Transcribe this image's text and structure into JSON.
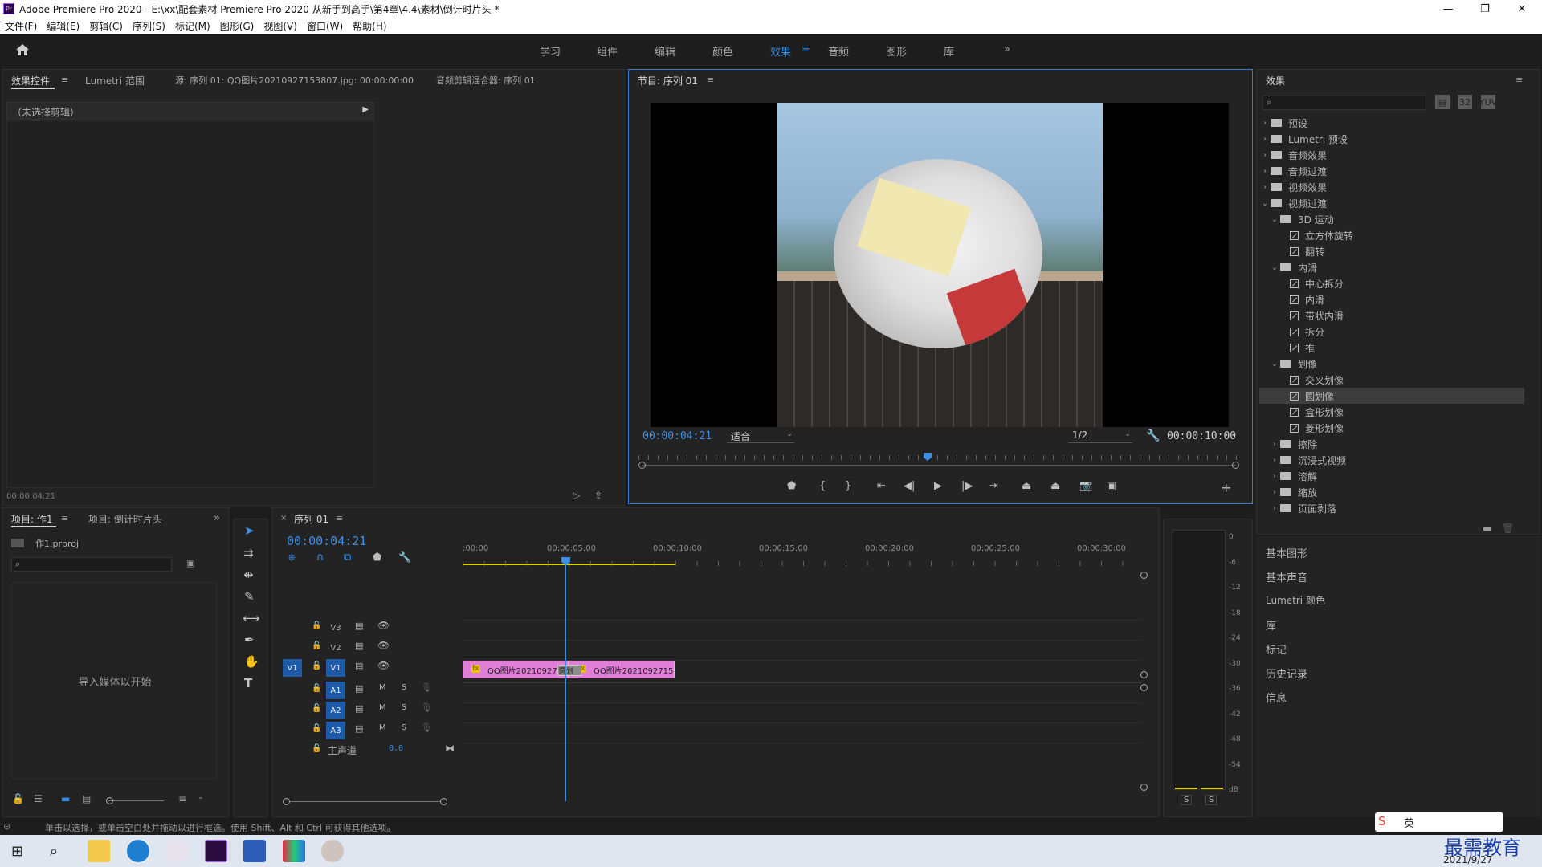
{
  "window": {
    "title": "Adobe Premiere Pro 2020 - E:\\xx\\配套素材 Premiere Pro 2020 从新手到高手\\第4章\\4.4\\素材\\倒计时片头 *",
    "app_icon_label": "Pr",
    "controls": {
      "minimize": "—",
      "maximize": "❐",
      "close": "✕"
    }
  },
  "menu": [
    "文件(F)",
    "编辑(E)",
    "剪辑(C)",
    "序列(S)",
    "标记(M)",
    "图形(G)",
    "视图(V)",
    "窗口(W)",
    "帮助(H)"
  ],
  "workspaces": {
    "items": [
      "学习",
      "组件",
      "编辑",
      "颜色",
      "效果",
      "音频",
      "图形",
      "库"
    ],
    "active": "效果",
    "more": "»"
  },
  "source_panel": {
    "tabs": [
      "效果控件",
      "Lumetri 范围",
      "源: 序列 01: QQ图片20210927153807.jpg: 00:00:00:00",
      "音频剪辑混合器: 序列 01"
    ],
    "no_clip": "（未选择剪辑）",
    "timecode": "00:00:04:21"
  },
  "program": {
    "title": "节目: 序列 01",
    "timecode": "00:00:04:21",
    "fit": "适合",
    "resolution": "1/2",
    "duration": "00:00:10:00",
    "playhead_fraction": 0.481
  },
  "effects": {
    "title": "效果",
    "tree": [
      {
        "level": 0,
        "kind": "folder",
        "expanded": false,
        "label": "预设"
      },
      {
        "level": 0,
        "kind": "folder",
        "expanded": false,
        "label": "Lumetri 预设"
      },
      {
        "level": 0,
        "kind": "folder",
        "expanded": false,
        "label": "音频效果"
      },
      {
        "level": 0,
        "kind": "folder",
        "expanded": false,
        "label": "音频过渡"
      },
      {
        "level": 0,
        "kind": "folder",
        "expanded": false,
        "label": "视频效果"
      },
      {
        "level": 0,
        "kind": "folder",
        "expanded": true,
        "label": "视频过渡"
      },
      {
        "level": 1,
        "kind": "folder",
        "expanded": true,
        "label": "3D 运动"
      },
      {
        "level": 2,
        "kind": "fx",
        "label": "立方体旋转"
      },
      {
        "level": 2,
        "kind": "fx",
        "label": "翻转"
      },
      {
        "level": 1,
        "kind": "folder",
        "expanded": true,
        "label": "内滑"
      },
      {
        "level": 2,
        "kind": "fx",
        "label": "中心拆分"
      },
      {
        "level": 2,
        "kind": "fx",
        "label": "内滑"
      },
      {
        "level": 2,
        "kind": "fx",
        "label": "带状内滑"
      },
      {
        "level": 2,
        "kind": "fx",
        "label": "拆分"
      },
      {
        "level": 2,
        "kind": "fx",
        "label": "推"
      },
      {
        "level": 1,
        "kind": "folder",
        "expanded": true,
        "label": "划像"
      },
      {
        "level": 2,
        "kind": "fx",
        "label": "交叉划像"
      },
      {
        "level": 2,
        "kind": "fx",
        "label": "圆划像",
        "selected": true
      },
      {
        "level": 2,
        "kind": "fx",
        "label": "盒形划像"
      },
      {
        "level": 2,
        "kind": "fx",
        "label": "菱形划像"
      },
      {
        "level": 1,
        "kind": "folder",
        "expanded": false,
        "label": "擦除"
      },
      {
        "level": 1,
        "kind": "folder",
        "expanded": false,
        "label": "沉浸式视频"
      },
      {
        "level": 1,
        "kind": "folder",
        "expanded": false,
        "label": "溶解"
      },
      {
        "level": 1,
        "kind": "folder",
        "expanded": false,
        "label": "缩放"
      },
      {
        "level": 1,
        "kind": "folder",
        "expanded": false,
        "label": "页面剥落"
      }
    ]
  },
  "side_panels": [
    "基本图形",
    "基本声音",
    "Lumetri 颜色",
    "库",
    "标记",
    "历史记录",
    "信息"
  ],
  "project": {
    "tabs": [
      "项目: 作1",
      "项目: 倒计时片头"
    ],
    "file": "作1.prproj",
    "empty": "导入媒体以开始"
  },
  "timeline": {
    "tab": "序列 01",
    "timecode": "00:00:04:21",
    "ruler": [
      ":00:00",
      "00:00:05:00",
      "00:00:10:00",
      "00:00:15:00",
      "00:00:20:00",
      "00:00:25:00",
      "00:00:30:00"
    ],
    "video_tracks": [
      "V3",
      "V2",
      "V1"
    ],
    "source_patch": "V1",
    "audio_tracks": [
      "A1",
      "A2",
      "A3"
    ],
    "master": {
      "label": "主声道",
      "value": "0.0"
    },
    "clips": [
      {
        "label": "QQ图片2021092715",
        "fx": "fx"
      },
      {
        "label": "QQ图片2021092715",
        "fx": "fx"
      }
    ],
    "transition_label": "圆划"
  },
  "meter": {
    "scale": [
      "0",
      "-6",
      "-12",
      "-18",
      "-24",
      "-30",
      "-36",
      "-42",
      "-48",
      "-54",
      "dB"
    ],
    "solo": [
      "S",
      "S"
    ]
  },
  "status_bar": "单击以选择，或单击空白处并拖动以进行框选。使用 Shift、Alt 和 Ctrl 可获得其他选项。",
  "taskbar": {
    "date": "2021/9/27",
    "tray_text": "英",
    "watermark": "最需教育"
  }
}
